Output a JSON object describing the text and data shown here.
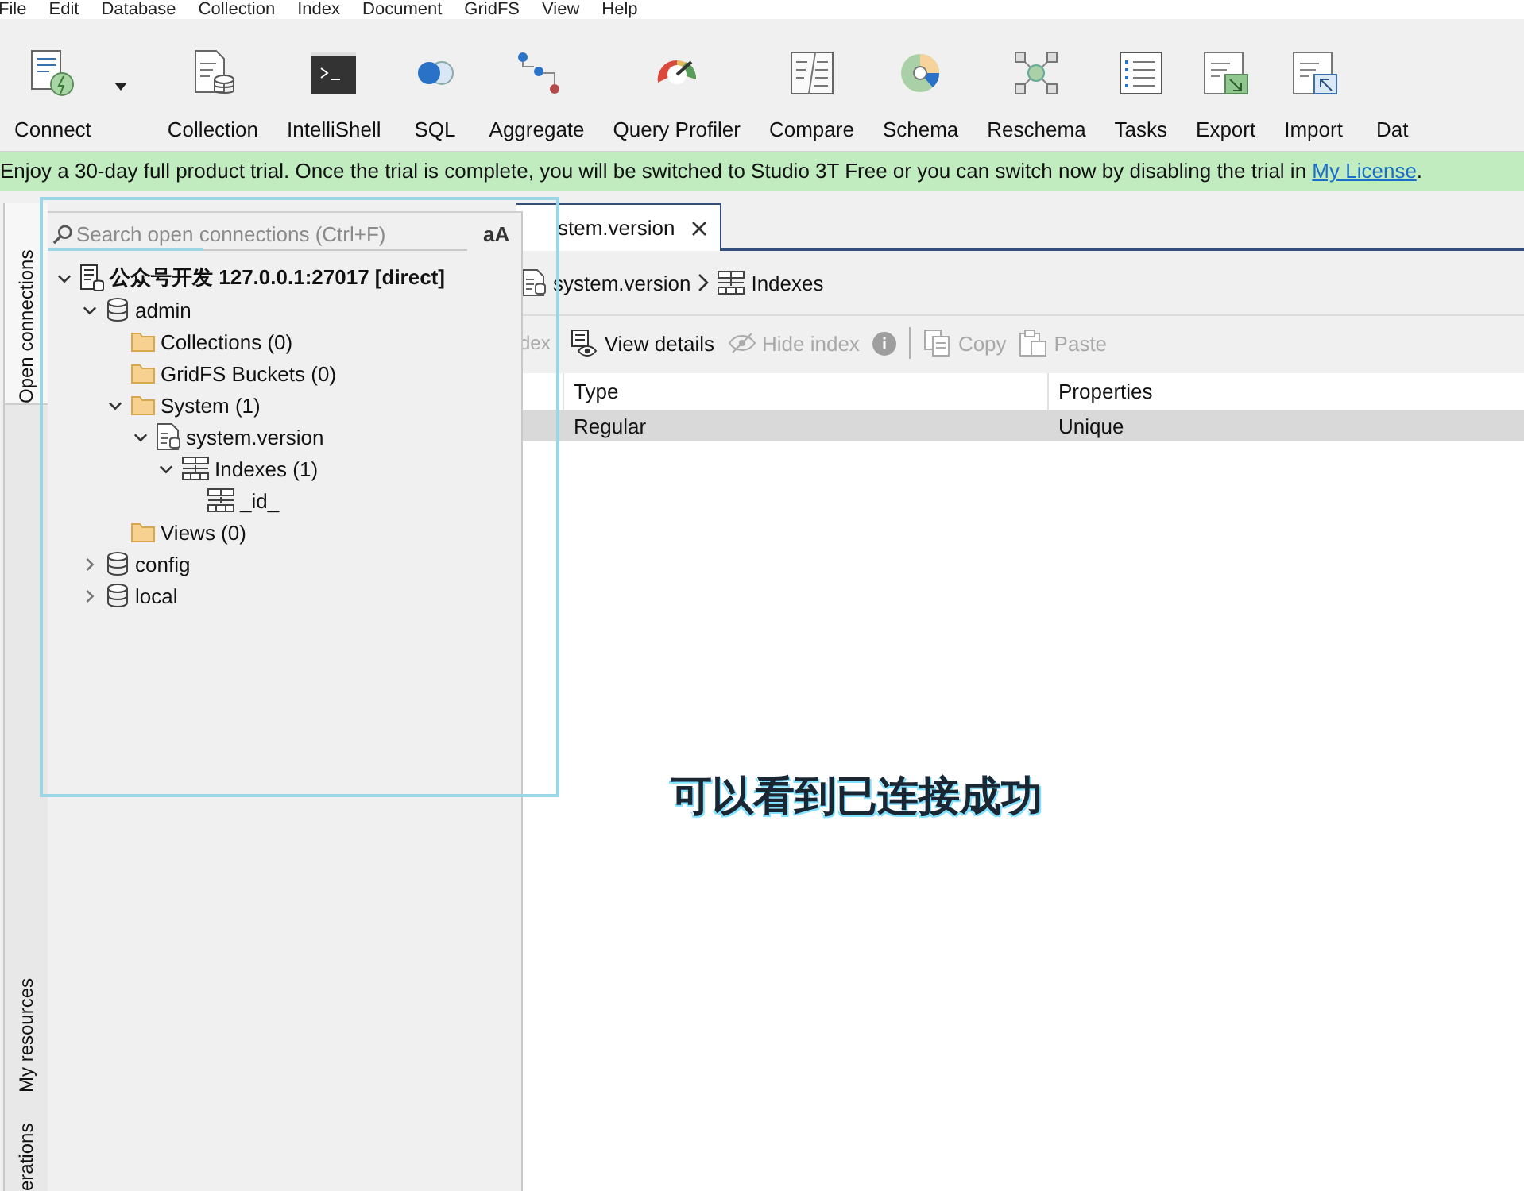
{
  "menu": [
    "File",
    "Edit",
    "Database",
    "Collection",
    "Index",
    "Document",
    "GridFS",
    "View",
    "Help"
  ],
  "toolbar": [
    {
      "label": "Connect",
      "has_menu": true
    },
    {
      "label": "Collection"
    },
    {
      "label": "IntelliShell"
    },
    {
      "label": "SQL"
    },
    {
      "label": "Aggregate"
    },
    {
      "label": "Query Profiler"
    },
    {
      "label": "Compare"
    },
    {
      "label": "Schema"
    },
    {
      "label": "Reschema"
    },
    {
      "label": "Tasks"
    },
    {
      "label": "Export"
    },
    {
      "label": "Import"
    },
    {
      "label": "Dat"
    }
  ],
  "trial_banner": {
    "text": "Enjoy a 30-day full product trial. Once the trial is complete, you will be switched to Studio 3T Free or you can switch now by disabling the trial in ",
    "link": "My License",
    "suffix": "."
  },
  "side_tabs": [
    {
      "label": "Open connections",
      "selected": true
    },
    {
      "label": "My resources",
      "selected": false
    },
    {
      "label": "erations",
      "selected": false
    }
  ],
  "editor": {
    "tab": {
      "label": "stem.version",
      "closable": true
    },
    "breadcrumb": [
      {
        "kind": "collection",
        "label": "system.version"
      },
      {
        "kind": "indexes",
        "label": "Indexes"
      }
    ],
    "actions": [
      {
        "kind": "text",
        "label": "dex",
        "disabled": true
      },
      {
        "kind": "view",
        "label": "View details",
        "disabled": false
      },
      {
        "kind": "hide",
        "label": "Hide index",
        "disabled": true
      },
      {
        "kind": "info",
        "disabled": true
      },
      {
        "kind": "separator"
      },
      {
        "kind": "copy",
        "label": "Copy",
        "disabled": true
      },
      {
        "kind": "paste",
        "label": "Paste",
        "disabled": true
      }
    ],
    "table": {
      "columns": [
        "Type",
        "Properties"
      ],
      "rows": [
        {
          "cells": [
            "Regular",
            "Unique"
          ],
          "selected": true
        }
      ]
    }
  },
  "connections_panel": {
    "search": {
      "placeholder": "Search open connections (Ctrl+F)"
    },
    "case_toggle": "aA",
    "tree": [
      {
        "kind": "server",
        "label": "公众号开发 127.0.0.1:27017 [direct]",
        "expanded": true,
        "children": [
          {
            "kind": "database",
            "label": "admin",
            "expanded": true,
            "children": [
              {
                "kind": "folder",
                "label": "Collections (0)"
              },
              {
                "kind": "folder",
                "label": "GridFS Buckets (0)"
              },
              {
                "kind": "folder",
                "label": "System (1)",
                "expanded": true,
                "children": [
                  {
                    "kind": "collection",
                    "label": "system.version",
                    "expanded": true,
                    "children": [
                      {
                        "kind": "indexes",
                        "label": "Indexes (1)",
                        "expanded": true,
                        "children": [
                          {
                            "kind": "index",
                            "label": "_id_"
                          }
                        ]
                      }
                    ]
                  }
                ]
              },
              {
                "kind": "folder",
                "label": "Views (0)"
              }
            ]
          },
          {
            "kind": "database",
            "label": "config",
            "expanded": false
          },
          {
            "kind": "database",
            "label": "local",
            "expanded": false
          }
        ]
      }
    ]
  },
  "caption": "可以看到已连接成功"
}
